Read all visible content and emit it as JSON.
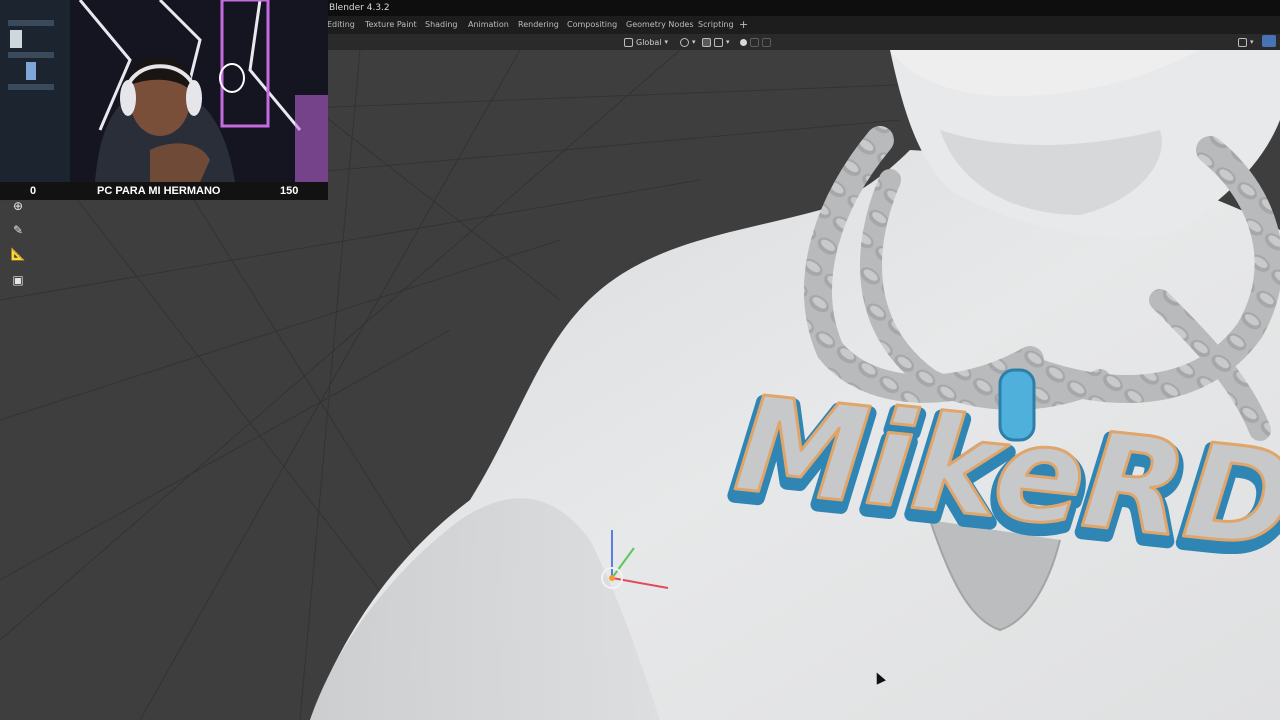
{
  "window": {
    "title": "Blender 4.3.2"
  },
  "workspace_tabs": [
    {
      "label": "Editing"
    },
    {
      "label": "Texture Paint"
    },
    {
      "label": "Shading"
    },
    {
      "label": "Animation"
    },
    {
      "label": "Rendering"
    },
    {
      "label": "Compositing"
    },
    {
      "label": "Geometry Nodes"
    },
    {
      "label": "Scripting"
    }
  ],
  "add_workspace_label": "+",
  "viewport_header": {
    "transform_orientation": "Global"
  },
  "viewport": {
    "model_text": "MikeRD"
  },
  "stream_overlay": {
    "goal_left": "0",
    "goal_label": "PC PARA MI HERMANO",
    "goal_right": "150"
  },
  "colors": {
    "accent_blue": "#4772b3",
    "pendant_outline": "#5ab4e0",
    "pendant_trim": "#e0a56a",
    "body": "#e6e7e8"
  }
}
